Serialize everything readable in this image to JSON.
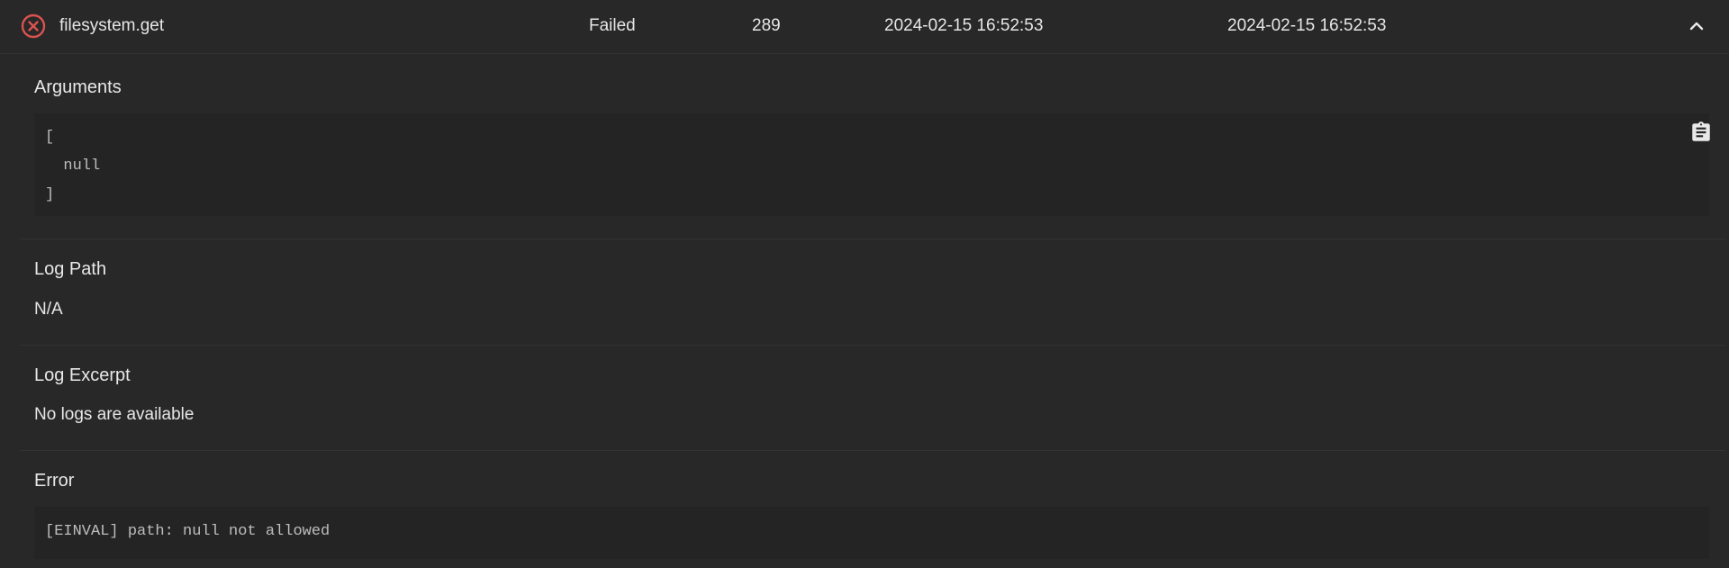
{
  "job": {
    "method": "filesystem.get",
    "state": "Failed",
    "id": "289",
    "started": "2024-02-15 16:52:53",
    "finished": "2024-02-15 16:52:53",
    "status_icon": "error-circle-icon",
    "collapse_icon": "chevron-up-icon",
    "error_color": "#d9534f"
  },
  "details": {
    "arguments": {
      "title": "Arguments",
      "lines": [
        "[",
        "  null",
        "]"
      ],
      "copy_icon": "clipboard-icon"
    },
    "log_path": {
      "title": "Log Path",
      "value": "N/A"
    },
    "log_excerpt": {
      "title": "Log Excerpt",
      "value": "No logs are available"
    },
    "error": {
      "title": "Error",
      "value": "[EINVAL] path: null not allowed"
    }
  }
}
